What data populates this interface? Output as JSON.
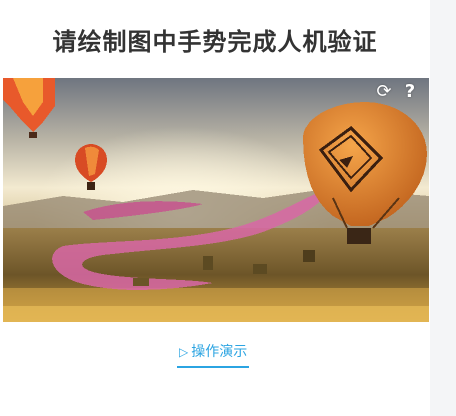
{
  "captcha": {
    "title": "请绘制图中手势完成人机验证",
    "demo_link_label": "操作演示",
    "icons": {
      "refresh": "refresh-icon",
      "help": "help-icon",
      "play": "play-triangle-icon"
    },
    "accent_color": "#2ba4e2",
    "title_color": "#333333"
  }
}
